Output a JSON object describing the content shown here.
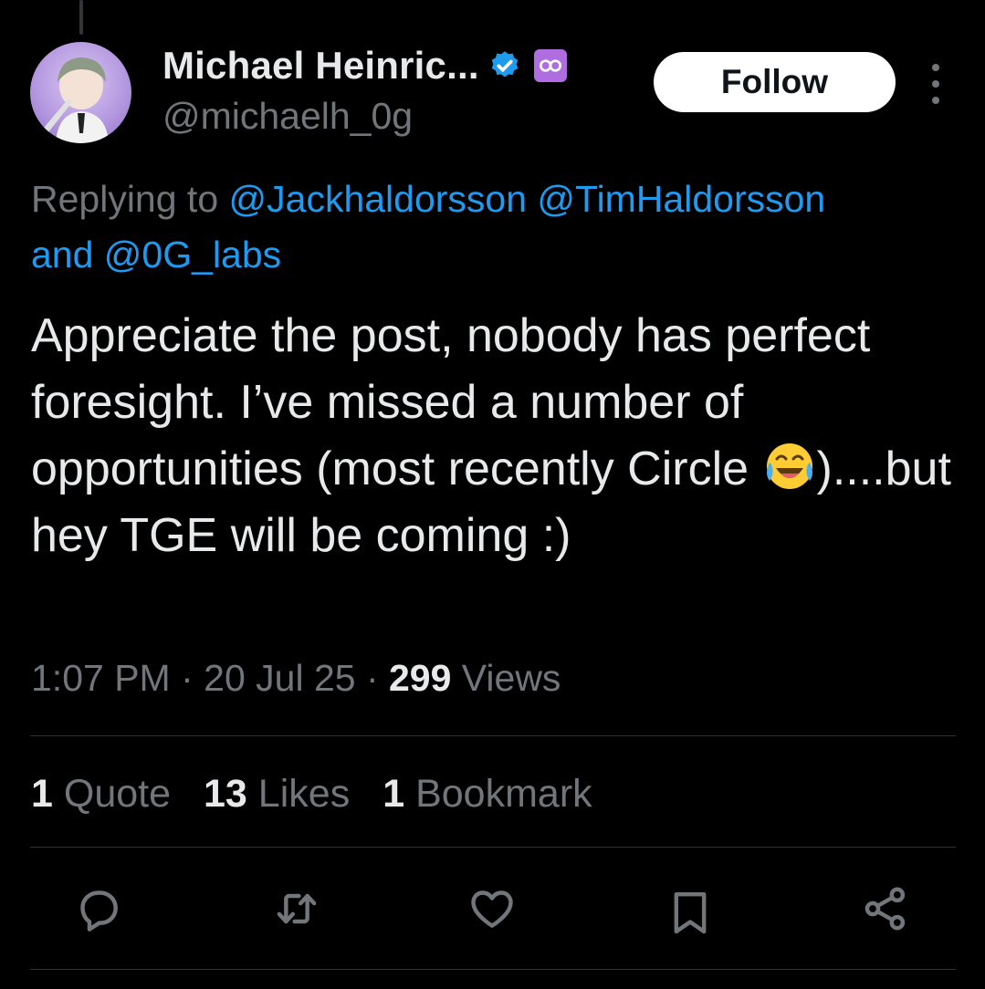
{
  "author": {
    "name": "Michael Heinric...",
    "handle": "@michaelh_0g",
    "verified_icon": "verified-badge-icon",
    "affiliation_icon": "0g-labs-badge-icon"
  },
  "header": {
    "follow_label": "Follow",
    "more_icon": "more-vertical-icon"
  },
  "reply": {
    "prefix": "Replying to ",
    "mention_1": "@Jackhaldorsson",
    "mention_2": "@TimHaldorsson",
    "mention_3": "and @0G_labs"
  },
  "tweet": {
    "text_before_emoji": "Appreciate the post, nobody has perfect foresight. I’ve missed a number of opportunities (most recently Circle ",
    "emoji": "face-with-tears-of-joy",
    "text_after_emoji": ")....but hey TGE will be coming :)"
  },
  "meta": {
    "time": "1:07 PM",
    "sep1": " · ",
    "date": "20 Jul 25",
    "sep2": " · ",
    "views_count": "299",
    "views_label": " Views"
  },
  "stats": {
    "quotes_count": "1",
    "quotes_label": " Quote",
    "likes_count": "13",
    "likes_label": " Likes",
    "bookmarks_count": "1",
    "bookmarks_label": " Bookmark"
  },
  "actions": [
    "reply-icon",
    "retweet-icon",
    "like-icon",
    "bookmark-icon",
    "share-icon"
  ],
  "colors": {
    "background": "#000000",
    "text": "#e7e9ea",
    "secondary": "#71767b",
    "link": "#1d9bf0",
    "divider": "#2f3336",
    "badge_purple": "#b06de0"
  }
}
